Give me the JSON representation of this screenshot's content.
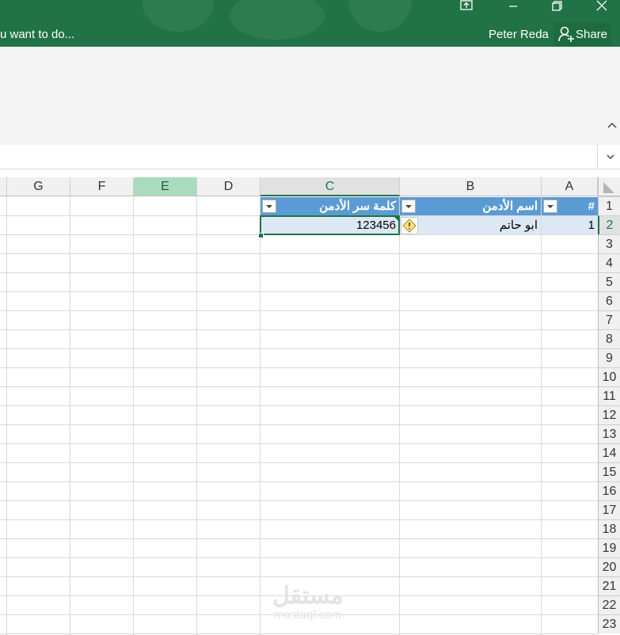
{
  "titlebar": {
    "tell_me": "u want to do...",
    "user_name": "Peter Reda",
    "share_label": "Share",
    "icons": [
      "ribbon-display-icon",
      "minimize-icon",
      "restore-icon",
      "close-icon"
    ]
  },
  "ribbon": {
    "collapse_icon": "chevron-up-icon"
  },
  "formula_bar": {
    "value": "",
    "expand_icon": "chevron-down-icon"
  },
  "columns": [
    "G",
    "F",
    "E",
    "D",
    "C",
    "B",
    "A"
  ],
  "rows": [
    "1",
    "2",
    "3",
    "4",
    "5",
    "6",
    "7",
    "8",
    "9",
    "10",
    "11",
    "12",
    "13",
    "14",
    "15",
    "16",
    "17",
    "18",
    "19",
    "20",
    "21",
    "22",
    "23"
  ],
  "table": {
    "headers": {
      "a": "#",
      "b": "اسم الأدمن",
      "c": "كلمة سر الأدمن"
    },
    "row1": {
      "a": "1",
      "b": "ابو حاتم",
      "c": "123456"
    }
  },
  "selection": {
    "active_cell": "C2",
    "selected_column_highlight": "E"
  },
  "watermark": {
    "arabic": "مستقل",
    "latin": "mostaql.com"
  },
  "colors": {
    "title_green": "#217346",
    "table_header": "#5b9bd5",
    "table_band": "#dde8f5"
  }
}
